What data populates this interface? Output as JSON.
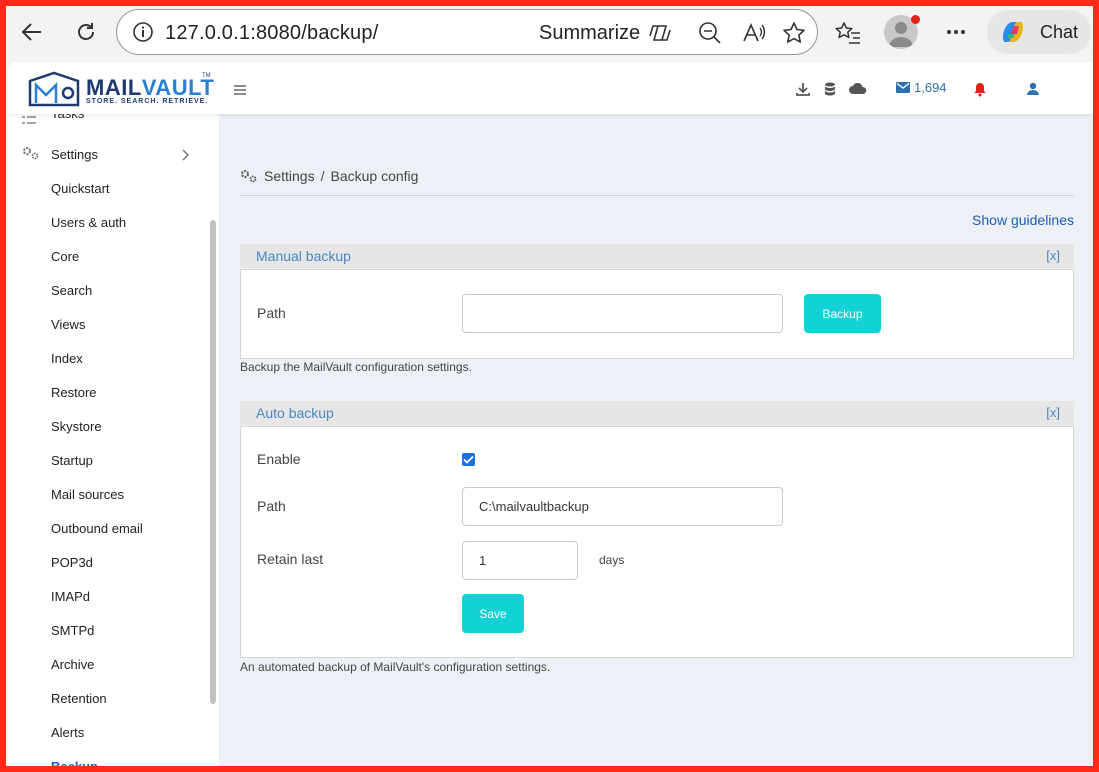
{
  "browser": {
    "url": "127.0.0.1:8080/backup/",
    "summarize_label": "Summarize",
    "chat_label": "Chat"
  },
  "app": {
    "logo_word_a": "MAIL",
    "logo_word_b": "VAULT",
    "logo_tm": "TM",
    "logo_tagline": "STORE. SEARCH. RETRIEVE.",
    "mail_count": "1,694"
  },
  "sidebar": {
    "top_partial": "Tasks",
    "settings_label": "Settings",
    "items": [
      {
        "label": "Quickstart"
      },
      {
        "label": "Users & auth"
      },
      {
        "label": "Core"
      },
      {
        "label": "Search"
      },
      {
        "label": "Views"
      },
      {
        "label": "Index"
      },
      {
        "label": "Restore"
      },
      {
        "label": "Skystore"
      },
      {
        "label": "Startup"
      },
      {
        "label": "Mail sources"
      },
      {
        "label": "Outbound email"
      },
      {
        "label": "POP3d"
      },
      {
        "label": "IMAPd"
      },
      {
        "label": "SMTPd"
      },
      {
        "label": "Archive"
      },
      {
        "label": "Retention"
      },
      {
        "label": "Alerts"
      },
      {
        "label": "Backup"
      }
    ],
    "active_index": 17
  },
  "main": {
    "breadcrumb": {
      "root": "Settings",
      "sep": "/",
      "current": "Backup config"
    },
    "show_guidelines": "Show guidelines",
    "manual": {
      "title": "Manual backup",
      "close": "[x]",
      "path_label": "Path",
      "path_value": "",
      "button": "Backup",
      "note": "Backup the MailVault configuration settings."
    },
    "auto": {
      "title": "Auto backup",
      "close": "[x]",
      "enable_label": "Enable",
      "enable_checked": true,
      "path_label": "Path",
      "path_value": "C:\\mailvaultbackup",
      "retain_label": "Retain last",
      "retain_value": "1",
      "retain_unit": "days",
      "save": "Save",
      "note": "An automated backup of MailVault's configuration settings."
    }
  }
}
